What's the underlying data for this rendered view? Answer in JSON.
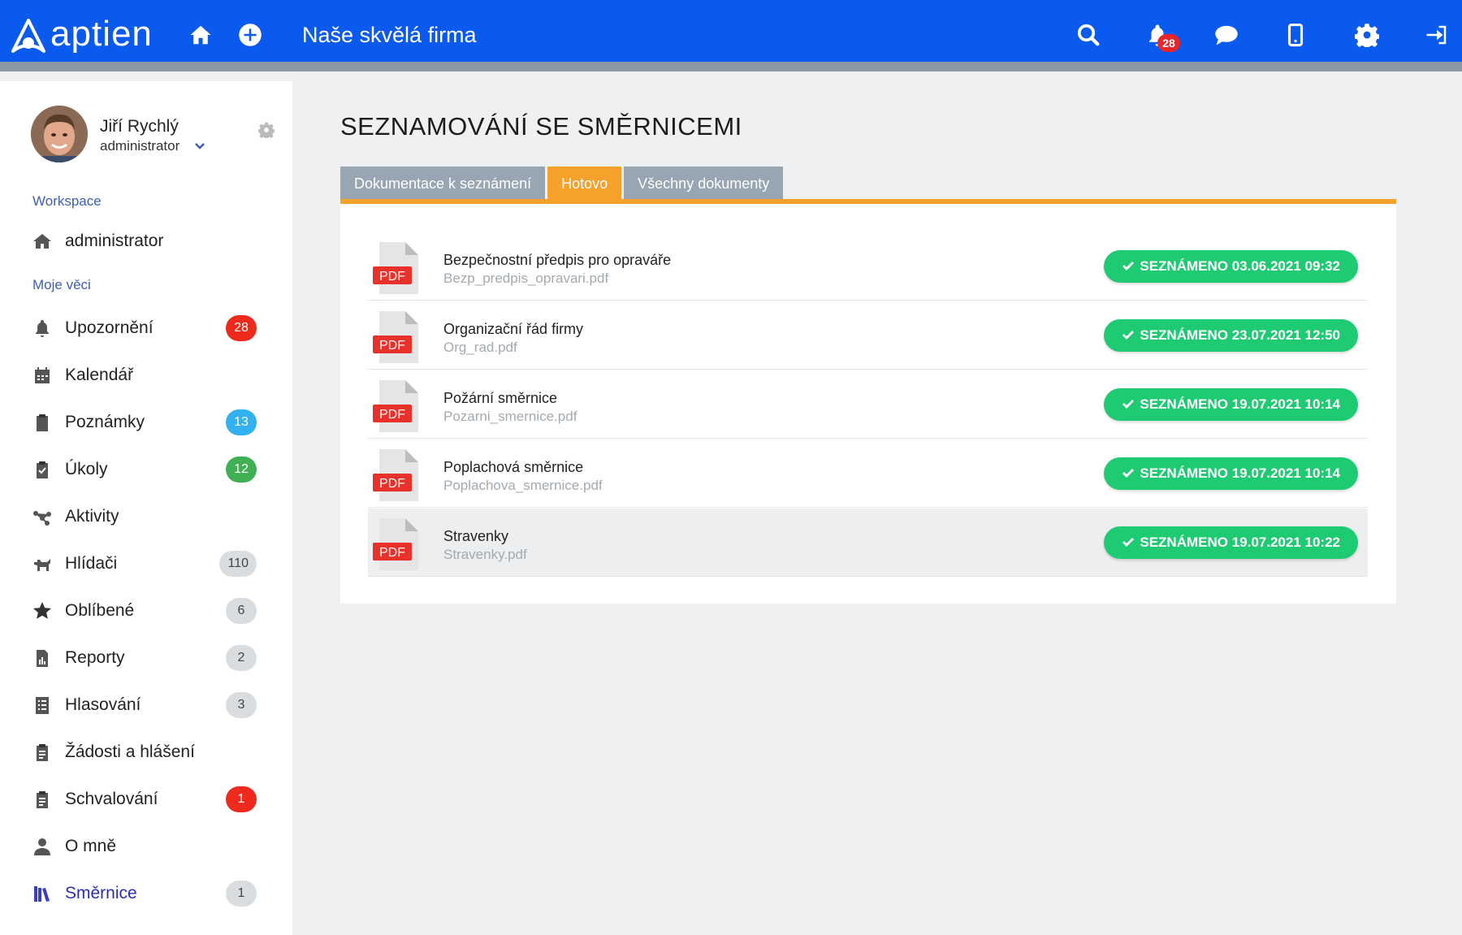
{
  "header": {
    "brand": "aptien",
    "company": "Naše skvělá firma",
    "notification_count": "28",
    "icons": [
      "home-icon",
      "plus-circle-icon",
      "search-icon",
      "bell-icon",
      "chat-icon",
      "mobile-icon",
      "gear-icon",
      "sign-out-icon"
    ],
    "color": "#0a5af0"
  },
  "user": {
    "name": "Jiří Rychlý",
    "role": "administrator"
  },
  "sidebar": {
    "workspace_label": "Workspace",
    "workspace_item": "administrator",
    "my_things_label": "Moje věci",
    "items": [
      {
        "label": "Upozornění",
        "badge": "28",
        "badge_color": "#ee2a1c",
        "icon": "bell-icon"
      },
      {
        "label": "Kalendář",
        "badge": "",
        "icon": "calendar-icon"
      },
      {
        "label": "Poznámky",
        "badge": "13",
        "badge_color": "#32b0ef",
        "icon": "clipboard-icon"
      },
      {
        "label": "Úkoly",
        "badge": "12",
        "badge_color": "#3fb054",
        "icon": "clipboard-check-icon"
      },
      {
        "label": "Aktivity",
        "badge": "",
        "icon": "activity-icon"
      },
      {
        "label": "Hlídači",
        "badge": "110",
        "badge_color": "#dadddf",
        "icon": "watchdog-icon"
      },
      {
        "label": "Oblíbené",
        "badge": "6",
        "badge_color": "#dadddf",
        "icon": "star-icon"
      },
      {
        "label": "Reporty",
        "badge": "2",
        "badge_color": "#dadddf",
        "icon": "report-icon"
      },
      {
        "label": "Hlasování",
        "badge": "3",
        "badge_color": "#dadddf",
        "icon": "poll-icon"
      },
      {
        "label": "Žádosti a hlášení",
        "badge": "",
        "icon": "request-icon"
      },
      {
        "label": "Schvalování",
        "badge": "1",
        "badge_color": "#ee2a1c",
        "icon": "approval-icon"
      },
      {
        "label": "O mně",
        "badge": "",
        "icon": "user-icon"
      },
      {
        "label": "Směrnice",
        "badge": "1",
        "badge_color": "#dadddf",
        "icon": "books-icon",
        "active": true
      }
    ]
  },
  "main": {
    "title": "SEZNAMOVÁNÍ SE SMĚRNICEMI",
    "tabs": [
      {
        "label": "Dokumentace k seznámení",
        "active": false
      },
      {
        "label": "Hotovo",
        "active": true
      },
      {
        "label": "Všechny dokumenty",
        "active": false
      }
    ],
    "documents": [
      {
        "title": "Bezpečnostní předpis pro opraváře",
        "file": "Bezp_predpis_opravari.pdf",
        "status": "SEZNÁMENO 03.06.2021 09:32"
      },
      {
        "title": "Organizační řád firmy",
        "file": "Org_rad.pdf",
        "status": "SEZNÁMENO 23.07.2021 12:50"
      },
      {
        "title": "Požární směrnice",
        "file": "Pozarni_smernice.pdf",
        "status": "SEZNÁMENO 19.07.2021 10:14"
      },
      {
        "title": "Poplachová směrnice",
        "file": "Poplachova_smernice.pdf",
        "status": "SEZNÁMENO 19.07.2021 10:14"
      },
      {
        "title": "Stravenky",
        "file": "Stravenky.pdf",
        "status": "SEZNÁMENO 19.07.2021 10:22"
      }
    ],
    "pdf_label": "PDF",
    "accent_color": "#f6a12a",
    "status_color": "#1ecb72"
  }
}
